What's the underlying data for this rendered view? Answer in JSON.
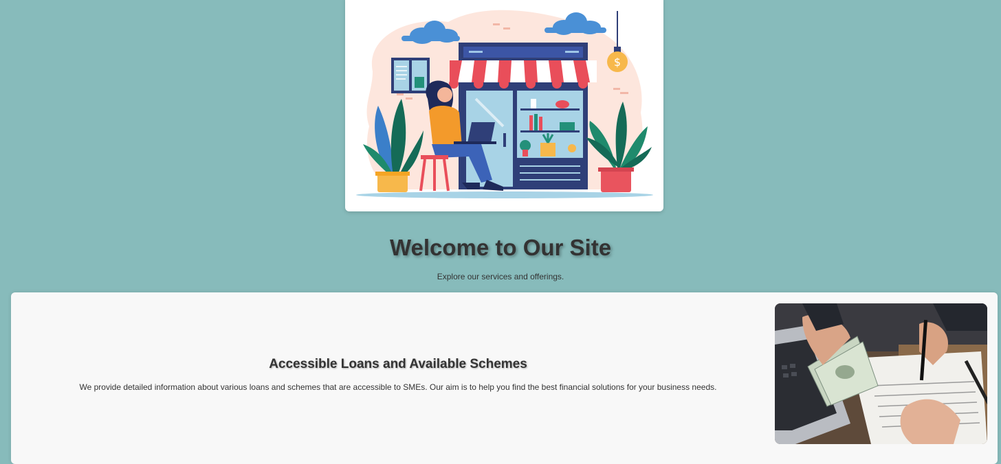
{
  "hero": {
    "title": "Welcome to Our Site",
    "subtitle": "Explore our services and offerings."
  },
  "section": {
    "heading": "Accessible Loans and Available Schemes",
    "text": "We provide detailed information about various loans and schemes that are accessible to SMEs. Our aim is to help you find the best financial solutions for your business needs."
  },
  "icons": {
    "illustration_sign": "dollar-sign-icon",
    "illustration_glyph": "$"
  },
  "colors": {
    "page_background": "#87bbbb",
    "card_background": "#ffffff",
    "section_background": "#f8f8f8",
    "text": "#333333"
  }
}
